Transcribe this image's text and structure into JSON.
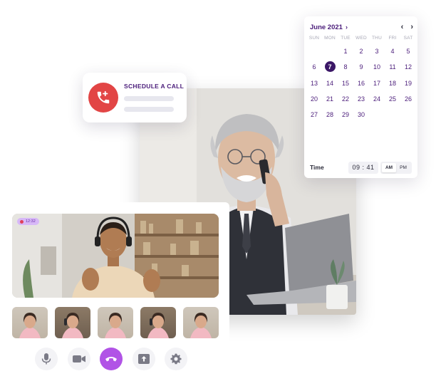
{
  "schedule": {
    "title": "SCHEDULE A CALL",
    "icon": "phone-plus-icon"
  },
  "calendar": {
    "month": "June 2021",
    "weekdays": [
      "SUN",
      "MON",
      "TUE",
      "WED",
      "THU",
      "FRI",
      "SAT"
    ],
    "days": [
      "",
      "",
      "1",
      "2",
      "3",
      "4",
      "5",
      "6",
      "7",
      "8",
      "9",
      "10",
      "11",
      "12",
      "13",
      "14",
      "15",
      "16",
      "17",
      "18",
      "19",
      "20",
      "21",
      "22",
      "23",
      "24",
      "25",
      "26",
      "27",
      "28",
      "29",
      "30",
      "",
      "",
      ""
    ],
    "selected_day": "7",
    "time_label": "Time",
    "time_value": "09 : 41",
    "am_label": "AM",
    "pm_label": "PM",
    "active_period": "AM"
  },
  "call": {
    "rec_time": "12:32",
    "controls": [
      {
        "name": "microphone-button",
        "icon": "microphone-icon"
      },
      {
        "name": "camera-button",
        "icon": "video-camera-icon"
      },
      {
        "name": "end-call-button",
        "icon": "phone-hangup-icon"
      },
      {
        "name": "share-screen-button",
        "icon": "share-screen-icon"
      },
      {
        "name": "settings-button",
        "icon": "gear-icon"
      }
    ]
  },
  "colors": {
    "accent": "#4a1c7a",
    "end_call": "#b153e6",
    "schedule_icon_bg": "#e24545",
    "selected_day_bg": "#3b1766"
  }
}
